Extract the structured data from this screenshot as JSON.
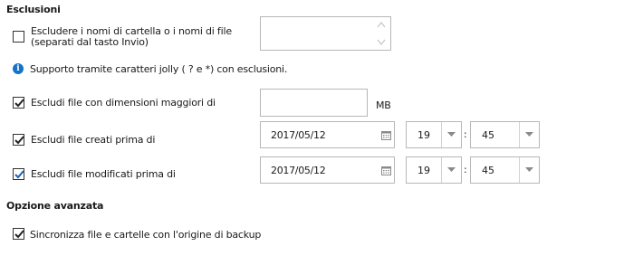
{
  "exclusions": {
    "title": "Esclusioni",
    "exclude_names": {
      "label_line1": "Escludere i nomi di cartella o i nomi di file",
      "label_line2": "(separati dal tasto Invio)",
      "checked": false,
      "value": ""
    },
    "info_text": "Supporto tramite caratteri jolly ( ? e *) con esclusioni.",
    "size_filter": {
      "label": "Escludi file con dimensioni maggiori di",
      "checked": true,
      "value": "",
      "unit": "MB"
    },
    "created_filter": {
      "label": "Escludi file creati prima di",
      "checked": true,
      "date": "2017/05/12",
      "hour": "19",
      "separator": ":",
      "minute": "45"
    },
    "modified_filter": {
      "label": "Escludi file modificati prima di",
      "checked": true,
      "date": "2017/05/12",
      "hour": "19",
      "separator": ":",
      "minute": "45"
    }
  },
  "advanced": {
    "title": "Opzione avanzata",
    "sync_option": {
      "label": "Sincronizza file e cartelle con l'origine di backup",
      "checked": true
    }
  },
  "icons": {
    "info": "info-icon",
    "calendar": "calendar-icon",
    "dropdown": "chevron-down-icon",
    "spinner": "spinner-arrows-icon",
    "check": "checkmark-icon"
  },
  "colors": {
    "check_blue": "#1e5fb4",
    "check_dark": "#222222",
    "info_blue": "#1473c8",
    "border": "#b7b7b7"
  }
}
